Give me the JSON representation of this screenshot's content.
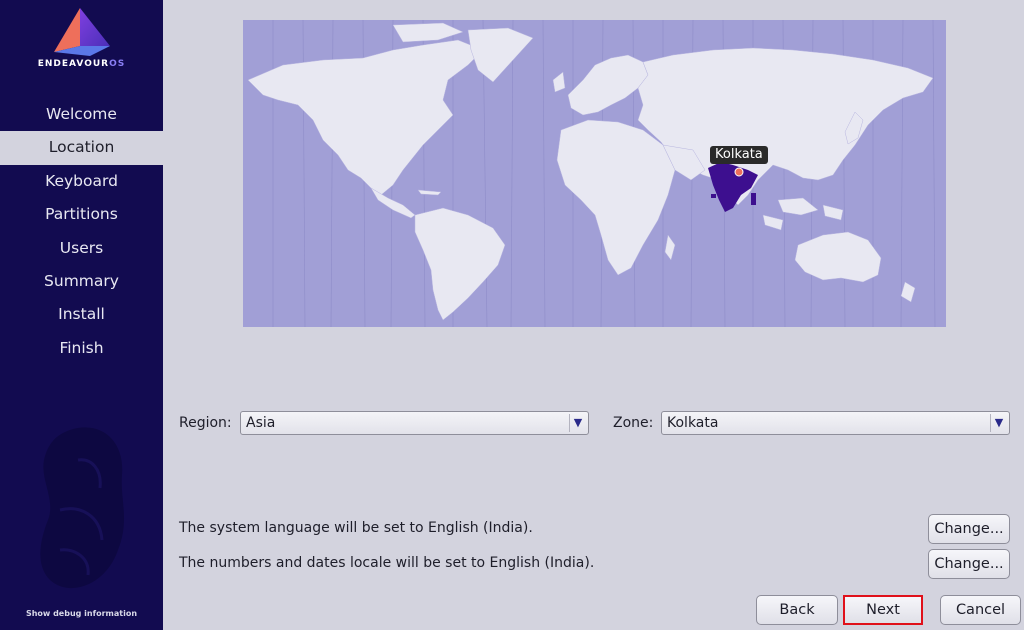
{
  "brand": {
    "name_main": "ENDEAVOUR",
    "name_accent": "OS"
  },
  "sidebar": {
    "items": [
      {
        "label": "Welcome",
        "active": false
      },
      {
        "label": "Location",
        "active": true
      },
      {
        "label": "Keyboard",
        "active": false
      },
      {
        "label": "Partitions",
        "active": false
      },
      {
        "label": "Users",
        "active": false
      },
      {
        "label": "Summary",
        "active": false
      },
      {
        "label": "Install",
        "active": false
      },
      {
        "label": "Finish",
        "active": false
      }
    ],
    "debug_label": "Show debug information"
  },
  "map": {
    "timezone_label": "Kolkata",
    "highlight_color": "#3d0f8f"
  },
  "region": {
    "label": "Region:",
    "value": "Asia"
  },
  "zone": {
    "label": "Zone:",
    "value": "Kolkata"
  },
  "locale": {
    "language_text": "The system language will be set to English (India).",
    "numbers_text": "The numbers and dates locale will be set to English (India).",
    "change_label": "Change..."
  },
  "buttons": {
    "back": "Back",
    "next": "Next",
    "cancel": "Cancel"
  },
  "colors": {
    "sidebar_bg": "#120b50",
    "content_bg": "#d3d3de",
    "map_sea": "#a19fd6",
    "land": "#e8e8f2",
    "highlight_border": "#e0101a"
  }
}
